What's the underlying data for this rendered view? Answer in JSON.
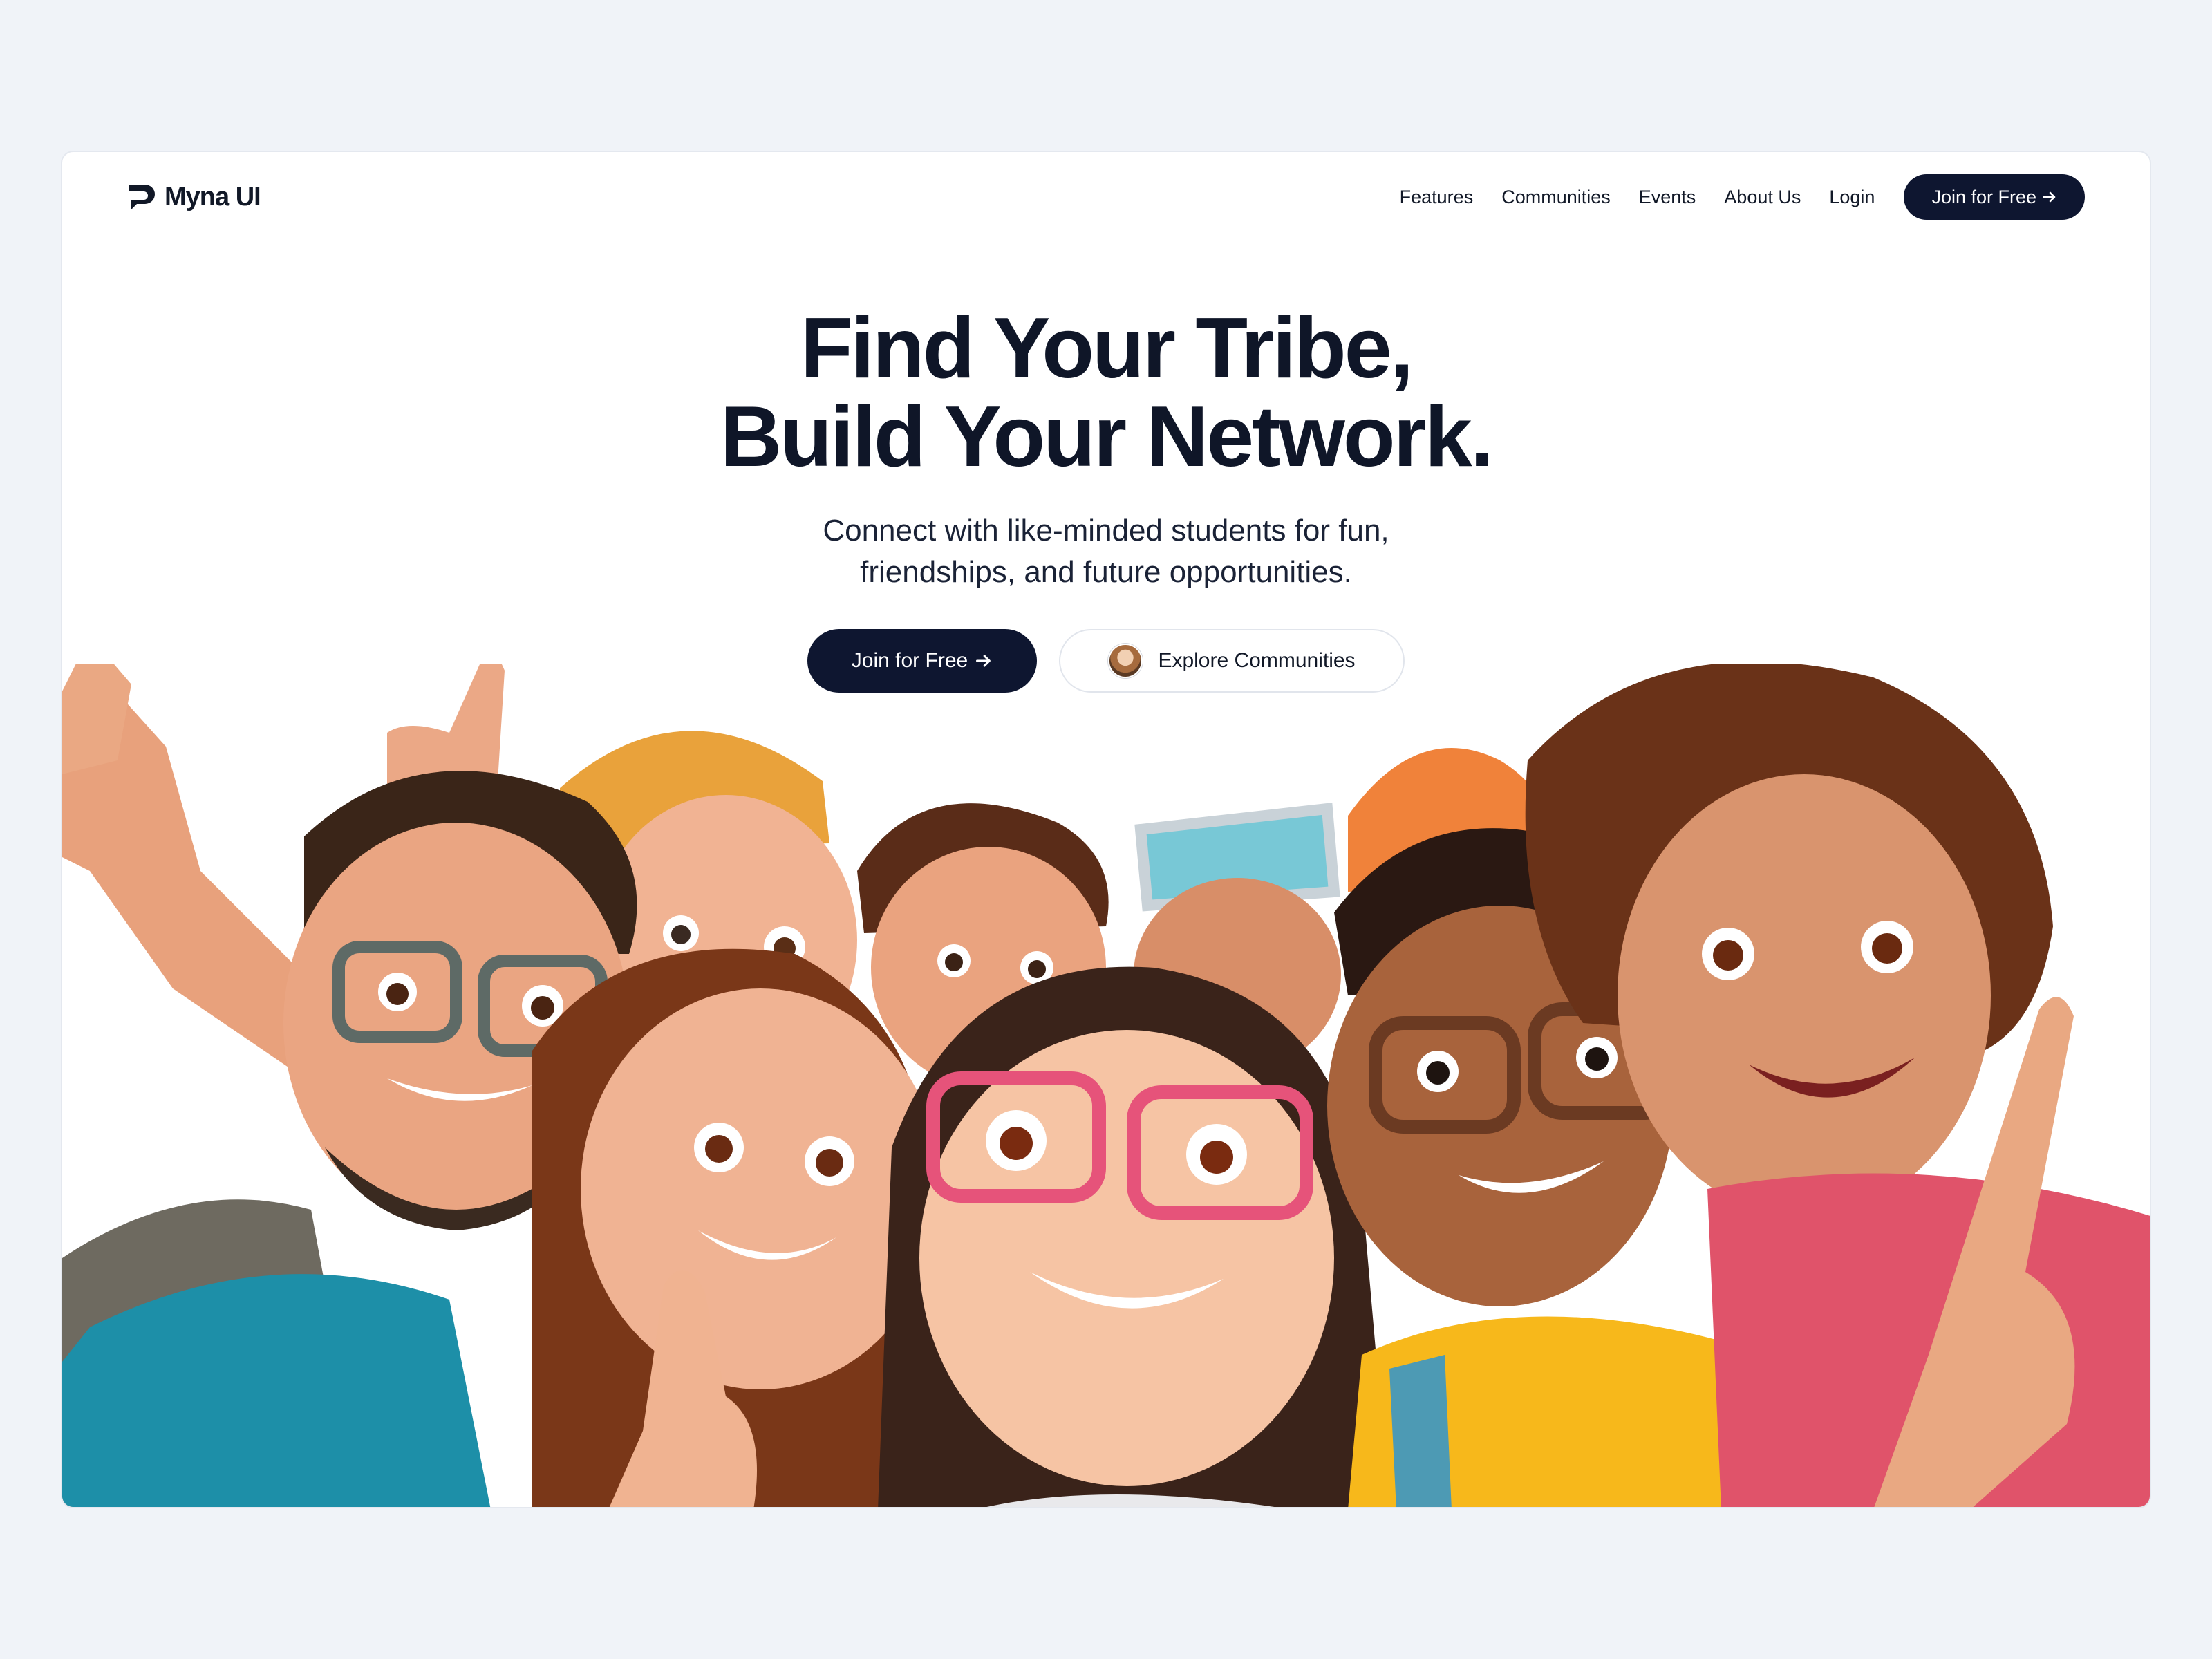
{
  "brand": {
    "name": "Myna UI",
    "logo_icon": "myna-logo-icon"
  },
  "nav": {
    "links": [
      "Features",
      "Communities",
      "Events",
      "About Us",
      "Login"
    ],
    "cta_label": "Join for Free"
  },
  "hero": {
    "title_line1": "Find Your Tribe,",
    "title_line2": "Build Your Network.",
    "subtitle_line1": "Connect with like-minded students for fun,",
    "subtitle_line2": "friendships, and future opportunities.",
    "primary_cta": "Join for Free",
    "secondary_cta": "Explore Communities"
  },
  "icons": {
    "arrow": "arrow-right-icon"
  },
  "colors": {
    "background": "#f0f3f8",
    "card": "#ffffff",
    "primary": "#0e1630",
    "text": "#0f1628"
  }
}
